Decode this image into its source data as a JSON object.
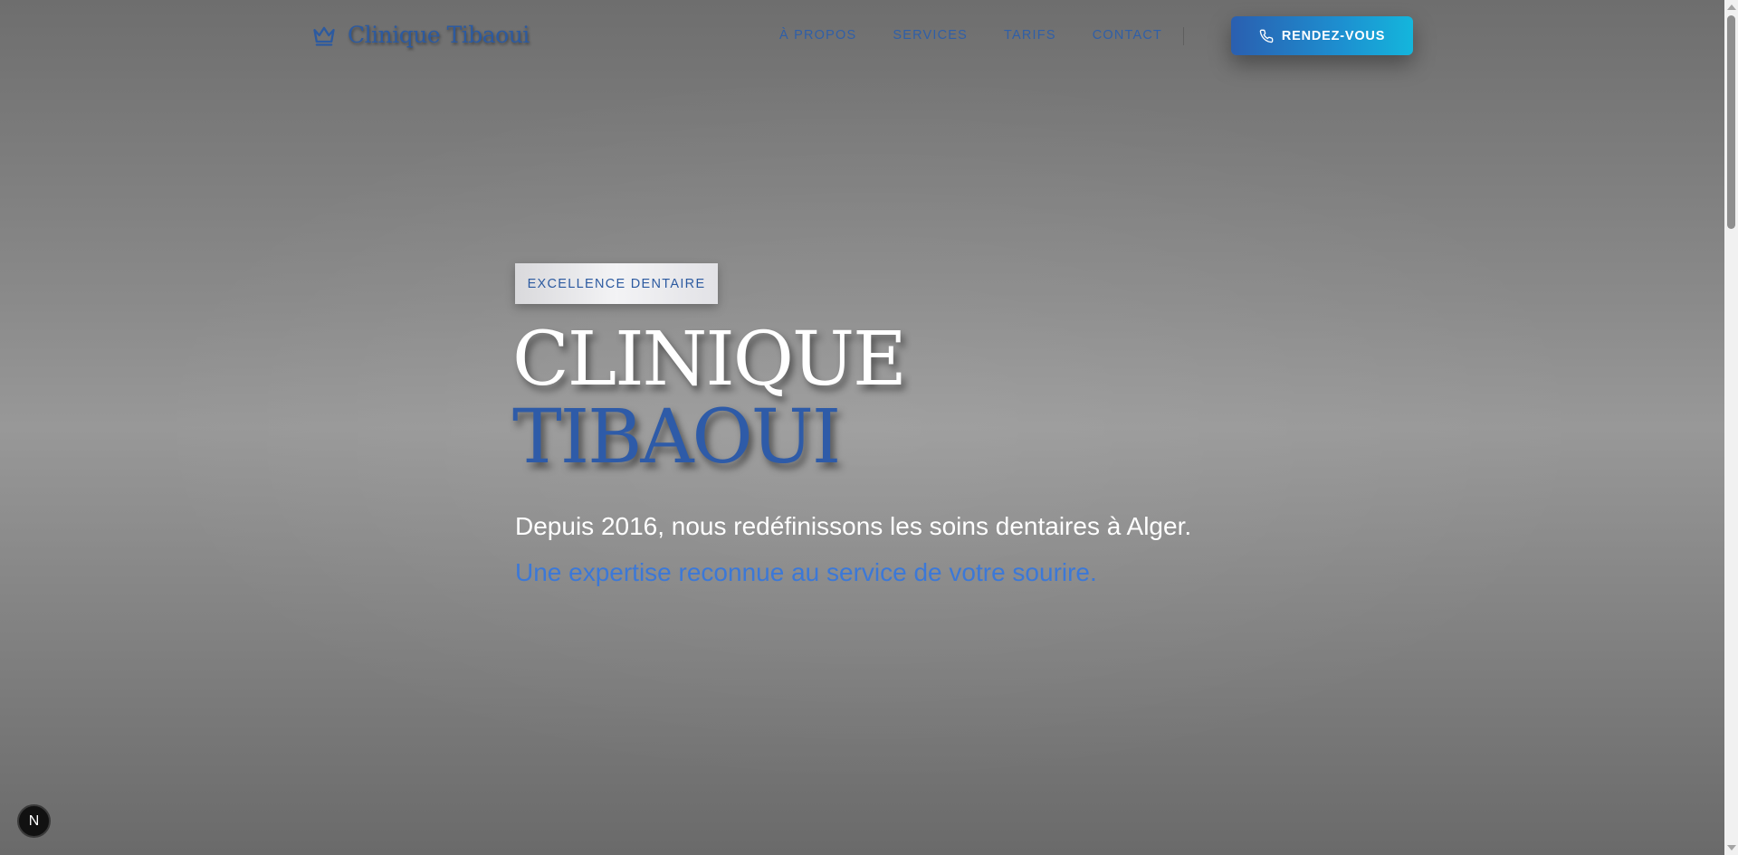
{
  "brand": {
    "name": "Clinique Tibaoui",
    "icon": "crown-icon",
    "color": "#2c5aa0"
  },
  "nav": {
    "items": [
      {
        "label": "À PROPOS"
      },
      {
        "label": "SERVICES"
      },
      {
        "label": "TARIFS"
      },
      {
        "label": "CONTACT"
      }
    ]
  },
  "cta": {
    "label": "RENDEZ-VOUS",
    "icon": "phone-icon",
    "gradient_from": "#2a5fb0",
    "gradient_to": "#14b6dc"
  },
  "hero": {
    "badge": "EXCELLENCE DENTAIRE",
    "title_line1": "CLINIQUE",
    "title_line2": "TIBAOUI",
    "subtitle": "Depuis 2016, nous redéfinissons les soins dentaires à Alger.",
    "tagline": "Une expertise reconnue au service de votre sourire.",
    "accent_color": "#3b78d8"
  },
  "floating_badge": {
    "label": "N"
  }
}
